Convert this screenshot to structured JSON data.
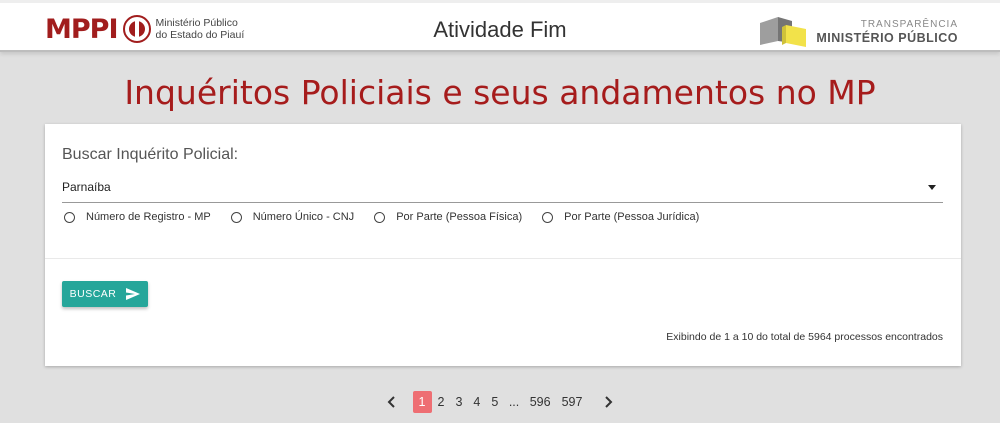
{
  "header": {
    "logo_text": "MPPI",
    "logo_sub_line1": "Ministério Público",
    "logo_sub_line2": "do Estado do Piauí",
    "app_title": "Atividade Fim",
    "transparency_top": "TRANSPARÊNCIA",
    "transparency_bottom": "MINISTÉRIO PÚBLICO"
  },
  "page_title": "Inquéritos Policiais e seus andamentos no MP",
  "search": {
    "label": "Buscar Inquérito Policial:",
    "selected_value": "Parnaíba",
    "options": [
      {
        "label": "Número de Registro - MP"
      },
      {
        "label": "Número Único - CNJ"
      },
      {
        "label": "Por Parte (Pessoa Física)"
      },
      {
        "label": "Por Parte (Pessoa Jurídica)"
      }
    ],
    "button_label": "BUSCAR"
  },
  "results": {
    "summary": "Exibindo de 1 a 10 do total de 5964 processos encontrados"
  },
  "pagination": {
    "pages": [
      "1",
      "2",
      "3",
      "4",
      "5"
    ],
    "ellipsis": "...",
    "last_pages": [
      "596",
      "597"
    ],
    "active": "1"
  },
  "colors": {
    "brand_red": "#a61c1c",
    "button_teal": "#26a69a",
    "active_page": "#ee6e73",
    "background": "#e0e0e0"
  },
  "icons": {
    "send": "send-icon",
    "prev": "chevron-left-icon",
    "next": "chevron-right-icon",
    "dropdown": "caret-down-icon"
  }
}
